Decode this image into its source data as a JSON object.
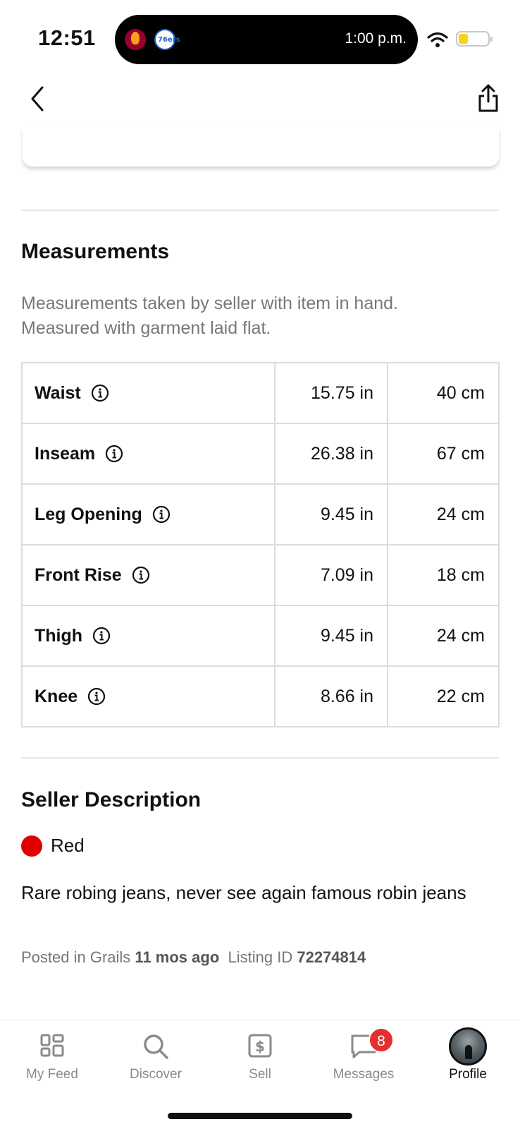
{
  "status_bar": {
    "clock": "12:51",
    "island_time": "1:00 p.m.",
    "left_logos": [
      "heat-logo",
      "sixers-logo"
    ],
    "sixers_logo_text": "76ers",
    "battery_color": "#f6d41c"
  },
  "header": {
    "back_icon": "chevron-left-icon",
    "share_icon": "share-icon"
  },
  "measurements": {
    "title": "Measurements",
    "note_line1": "Measurements taken by seller with item in hand.",
    "note_line2": "Measured with garment laid flat.",
    "rows": [
      {
        "label": "Waist",
        "inches": "15.75 in",
        "cm": "40 cm"
      },
      {
        "label": "Inseam",
        "inches": "26.38 in",
        "cm": "67 cm"
      },
      {
        "label": "Leg Opening",
        "inches": "9.45 in",
        "cm": "24 cm"
      },
      {
        "label": "Front Rise",
        "inches": "7.09 in",
        "cm": "18 cm"
      },
      {
        "label": "Thigh",
        "inches": "9.45 in",
        "cm": "24 cm"
      },
      {
        "label": "Knee",
        "inches": "8.66 in",
        "cm": "22 cm"
      }
    ]
  },
  "seller_description": {
    "title": "Seller Description",
    "color_name": "Red",
    "color_swatch": "#e00000",
    "text": "Rare robing jeans, never see again famous robin jeans"
  },
  "meta": {
    "posted_prefix": "Posted in Grails",
    "posted_age": "11 mos ago",
    "listing_prefix": "Listing ID",
    "listing_id": "72274814"
  },
  "tab_bar": {
    "tabs": [
      {
        "label": "My Feed",
        "icon": "grid-icon"
      },
      {
        "label": "Discover",
        "icon": "search-icon"
      },
      {
        "label": "Sell",
        "icon": "dollar-tag-icon"
      },
      {
        "label": "Messages",
        "icon": "chat-bubble-icon"
      },
      {
        "label": "Profile",
        "icon": "avatar"
      }
    ],
    "messages_badge": "8",
    "active_tab": "Profile"
  }
}
